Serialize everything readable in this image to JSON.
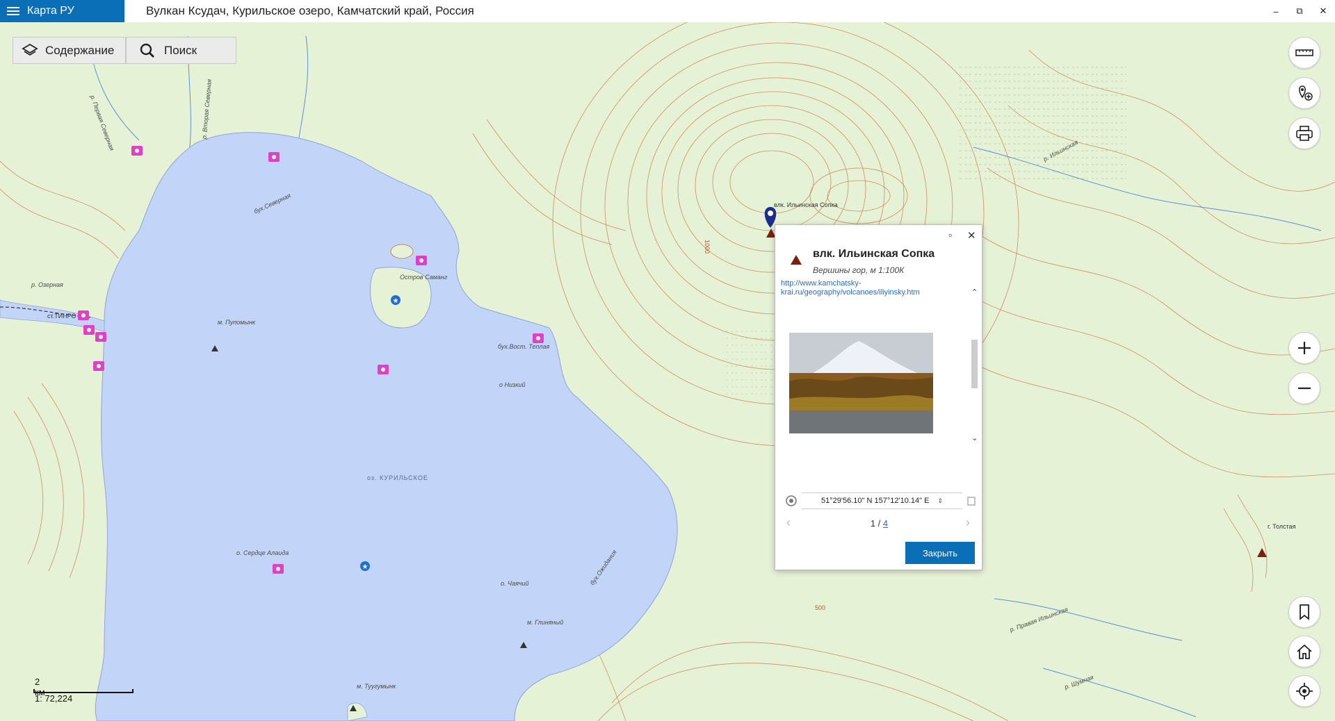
{
  "app": {
    "name": "Карта РУ",
    "title": "Вулкан Ксудач, Курильское озеро, Камчатский край, Россия"
  },
  "window_controls": {
    "minimize": "–",
    "restore": "⧉",
    "close": "✕"
  },
  "toolbar": {
    "contents_label": "Содержание",
    "search_label": "Поиск"
  },
  "map_labels": {
    "lake_name": "оз. КУРИЛЬСКОЕ",
    "station": "ст.ТИНРО",
    "river_ozernaya": "р. Озерная",
    "bay_severnaya": "бух.Северная",
    "island_samang": "Остров Саманг",
    "cape_pupomyn": "м. Пупомынк",
    "bay_vost_teplaya": "бух.Вост. Теплая",
    "island_nizkiy": "о Низкий",
    "island_serdtse": "о. Сердце Алаида",
    "island_chayachiy": "о. Чаячий",
    "bay_ozhidaniya": "бух.Ожидания",
    "cape_glinyaniy": "м. Глиняный",
    "cape_tuugumynk": "м. Туугумынк",
    "volcano_iliyinskaya": "влк. Ильинская Сопка",
    "mount_tolstaya": "г. Толстая",
    "river_ilyinskaya": "р. Ильинская",
    "river_pravaya": "р. Правая Ильинская",
    "river_shumnaya": "р. Шумная",
    "contour_1000": "1000",
    "contour_500": "500",
    "river_vtoraya": "р. Вторая Северная",
    "river_pervaya": "р. Первая Северная"
  },
  "popup": {
    "title": "влк. Ильинская Сопка",
    "subtitle": "Вершины гор, м 1:100К",
    "link": "http://www.kamchatsky-krai.ru/geography/volcanoes/iliyinsky.htm",
    "coordinates": "51°29'56.10\" N 157°12'10.14\" E",
    "page_current": "1 / ",
    "page_total": "4",
    "close_label": "Закрыть",
    "maximize": "▫"
  },
  "scale": {
    "distance": "2 км",
    "ratio": "1: 72,224"
  },
  "right_controls": [
    "ruler-icon",
    "add-place-icon",
    "print-icon",
    "zoom-in-icon",
    "zoom-out-icon",
    "bookmark-icon",
    "home-icon",
    "locate-icon"
  ],
  "colors": {
    "brand": "#0b6fb8",
    "water": "#c2d4f8",
    "land": "#e6f2d6",
    "contour": "#c96b3a",
    "poi": "#e23fc8"
  }
}
